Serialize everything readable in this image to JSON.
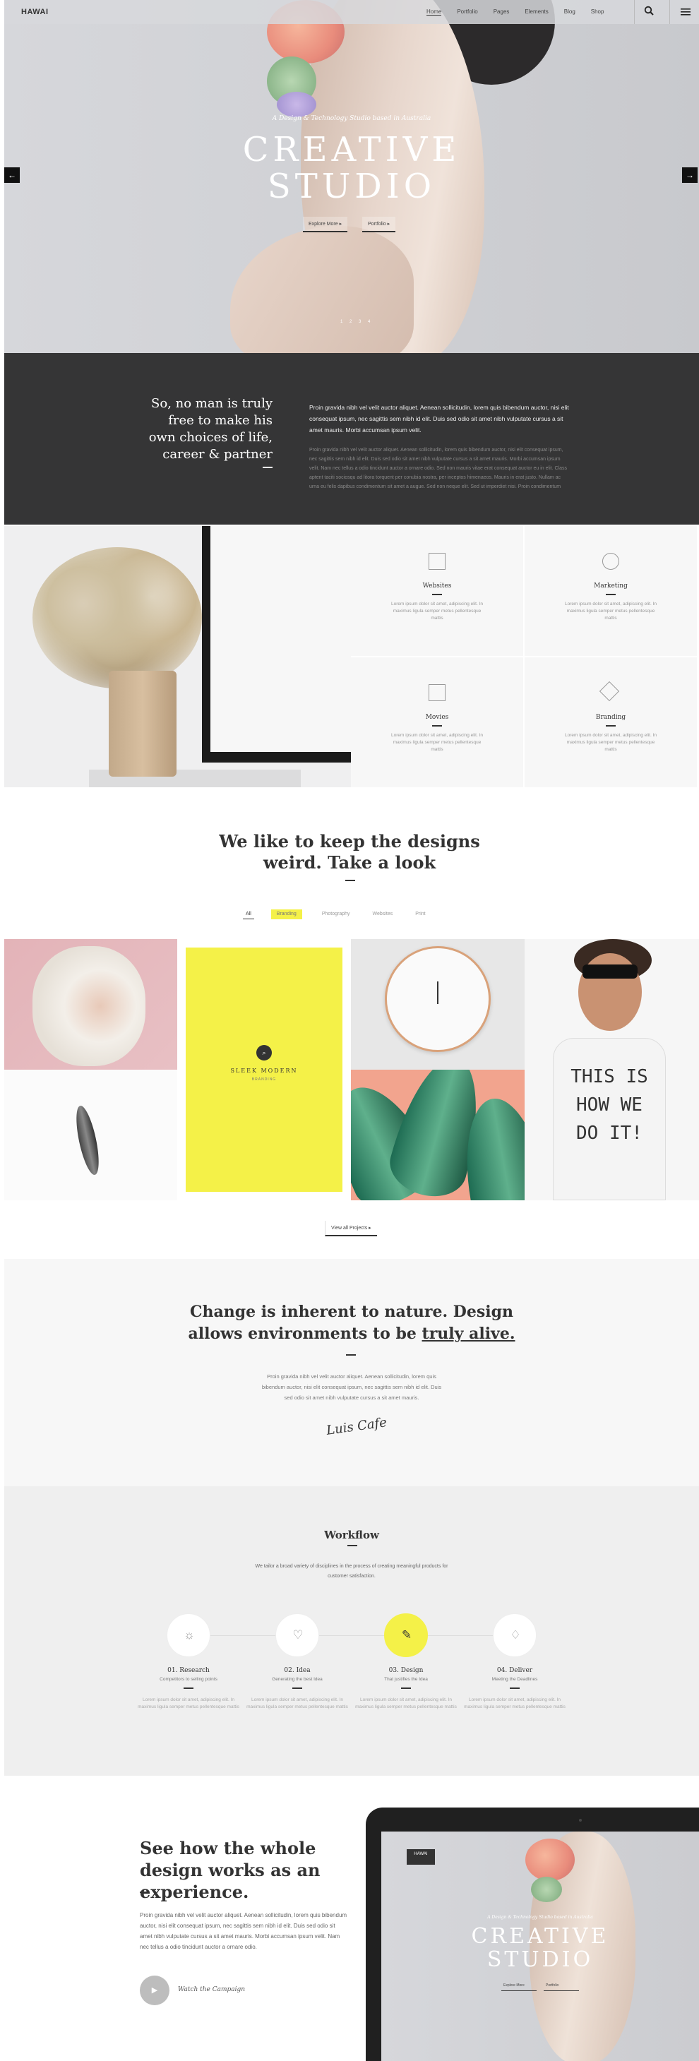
{
  "nav": {
    "logo": "HAWAI",
    "items": [
      "Home",
      "Portfolio",
      "Pages",
      "Elements",
      "Blog",
      "Shop"
    ]
  },
  "hero": {
    "subtitle": "A Design & Technology Studio based in Australia",
    "title_line1": "CREATIVE",
    "title_line2": "STUDIO",
    "buttons": [
      "Explore More",
      "Portfolio"
    ],
    "slider_dots": "1 2 3 4"
  },
  "intro": {
    "heading": "So, no man is truly free to make his own choices of life, career & partner",
    "paragraph_main": "Proin gravida nibh vel velit auctor aliquet. Aenean sollicitudin, lorem quis bibendum auctor, nisi elit consequat ipsum, nec sagittis sem nibh id elit. Duis sed odio sit amet nibh vulputate cursus a sit amet mauris. Morbi accumsan ipsum velit.",
    "paragraph_sub": "Proin gravida nibh vel velit auctor aliquet. Aenean sollicitudin, lorem quis bibendum auctor, nisi elit consequat ipsum, nec sagittis sem nibh id elit. Duis sed odio sit amet nibh vulputate cursus a sit amet mauris. Morbi accumsan ipsum velit. Nam nec tellus a odio tincidunt auctor a ornare odio. Sed non mauris vitae erat consequat auctor eu in elit. Class aptent taciti sociosqu ad litora torquent per conubia nostra, per inceptos himenaeos. Mauris in erat justo. Nullam ac urna eu felis dapibus condimentum sit amet a augue. Sed non neque elit. Sed ut imperdiet nisi. Proin condimentum fermentum nunc. Etiam pharetra, erat sed fermentum feugiat, velit mauris egestas quam, ut aliquam massa nisl quis neque. Suspendisse in orci enim."
  },
  "services": [
    {
      "name": "Websites",
      "desc": "Lorem ipsum dolor sit amet, adipiscing elit. In maximus ligula semper metus pellentesque mattis"
    },
    {
      "name": "Marketing",
      "desc": "Lorem ipsum dolor sit amet, adipiscing elit. In maximus ligula semper metus pellentesque mattis"
    },
    {
      "name": "Movies",
      "desc": "Lorem ipsum dolor sit amet, adipiscing elit. In maximus ligula semper metus pellentesque mattis"
    },
    {
      "name": "Branding",
      "desc": "Lorem ipsum dolor sit amet, adipiscing elit. In maximus ligula semper metus pellentesque mattis"
    }
  ],
  "portfolio": {
    "title_line1": "We like to keep the designs",
    "title_line2": "weird. Take a look",
    "filters": [
      "All",
      "Branding",
      "Photography",
      "Websites",
      "Print"
    ],
    "featured_title": "SLEEK MODERN",
    "featured_category": "BRANDING",
    "shirt_text": "THIS IS HOW WE DO IT!",
    "view_button": "View all Projects"
  },
  "quote": {
    "line1": "Change is inherent to nature. Design",
    "line2": "allows environments to be",
    "emph": "truly alive.",
    "text": "Proin gravida nibh vel velit auctor aliquet. Aenean sollicitudin, lorem quis bibendum auctor, nisi elit consequat ipsum, nec sagittis sem nibh id elit. Duis sed odio sit amet nibh vulputate cursus a sit amet mauris.",
    "signature": "Luis Cafe"
  },
  "workflow": {
    "title": "Workflow",
    "subtitle": "We tailor a broad variety of disciplines in the process of creating meaningful products for customer satisfaction.",
    "steps": [
      {
        "title": "01. Research",
        "sub": "Competitors to selling points",
        "desc": "Lorem ipsum dolor sit amet, adipiscing elit. In maximus ligula semper metus pellentesque mattis"
      },
      {
        "title": "02. Idea",
        "sub": "Generating the best Idea",
        "desc": "Lorem ipsum dolor sit amet, adipiscing elit. In maximus ligula semper metus pellentesque mattis"
      },
      {
        "title": "03. Design",
        "sub": "That justifies the Idea",
        "desc": "Lorem ipsum dolor sit amet, adipiscing elit. In maximus ligula semper metus pellentesque mattis"
      },
      {
        "title": "04. Deliver",
        "sub": "Meeting the Deadlines",
        "desc": "Lorem ipsum dolor sit amet, adipiscing elit. In maximus ligula semper metus pellentesque mattis"
      }
    ]
  },
  "experience": {
    "title": "See how the whole design works as an experience.",
    "text": "Proin gravida nibh vel velit auctor aliquet. Aenean sollicitudin, lorem quis bibendum auctor, nisi elit consequat ipsum, nec sagittis sem nibh id elit. Duis sed odio sit amet nibh vulputate cursus a sit amet mauris. Morbi accumsan ipsum velit. Nam nec tellus a odio tincidunt auctor a ornare odio.",
    "watch": "Watch the Campaign",
    "screen_logo": "HAWAI",
    "screen_subtitle": "A Design & Technology Studio based in Australia",
    "screen_title_line1": "CREATIVE",
    "screen_title_line2": "STUDIO",
    "screen_buttons": [
      "Explore More",
      "Portfolio"
    ]
  },
  "colors": {
    "accent": "#f4f148",
    "dark": "#353536",
    "light_bg": "#f7f7f7"
  }
}
